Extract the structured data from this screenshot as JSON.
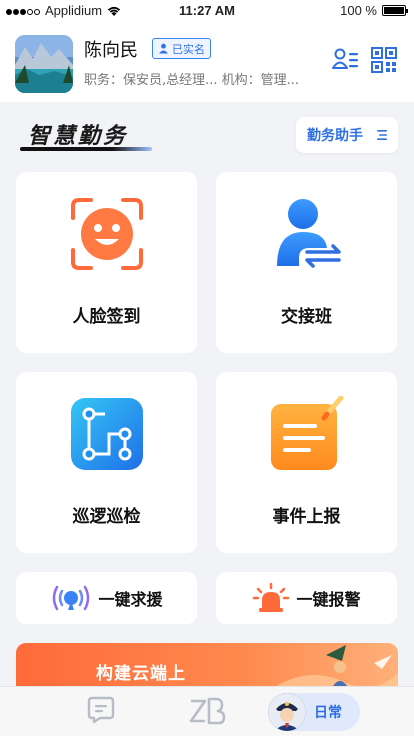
{
  "status_bar": {
    "carrier": "Applidium",
    "time": "11:27 AM",
    "battery": "100 %"
  },
  "header": {
    "name": "陈向民",
    "verified_label": "已实名",
    "subtitle": "职务：保安员,总经理... 机构：管理..."
  },
  "section": {
    "title": "智慧勤务",
    "assistant_label": "勤务助手"
  },
  "cards": [
    {
      "label": "人脸签到",
      "icon": "face-checkin-icon"
    },
    {
      "label": "交接班",
      "icon": "shift-handover-icon"
    },
    {
      "label": "巡逻巡检",
      "icon": "patrol-route-icon"
    },
    {
      "label": "事件上报",
      "icon": "event-report-icon"
    }
  ],
  "quick_actions": [
    {
      "label": "一键求援",
      "icon": "help-signal-icon"
    },
    {
      "label": "一键报警",
      "icon": "alarm-light-icon"
    }
  ],
  "banner": {
    "text": "构建云端上"
  },
  "tabbar": {
    "active_label": "日常"
  },
  "colors": {
    "accent": "#2f6fe0",
    "orange": "#ff6a3a",
    "background": "#f2f3f7"
  }
}
